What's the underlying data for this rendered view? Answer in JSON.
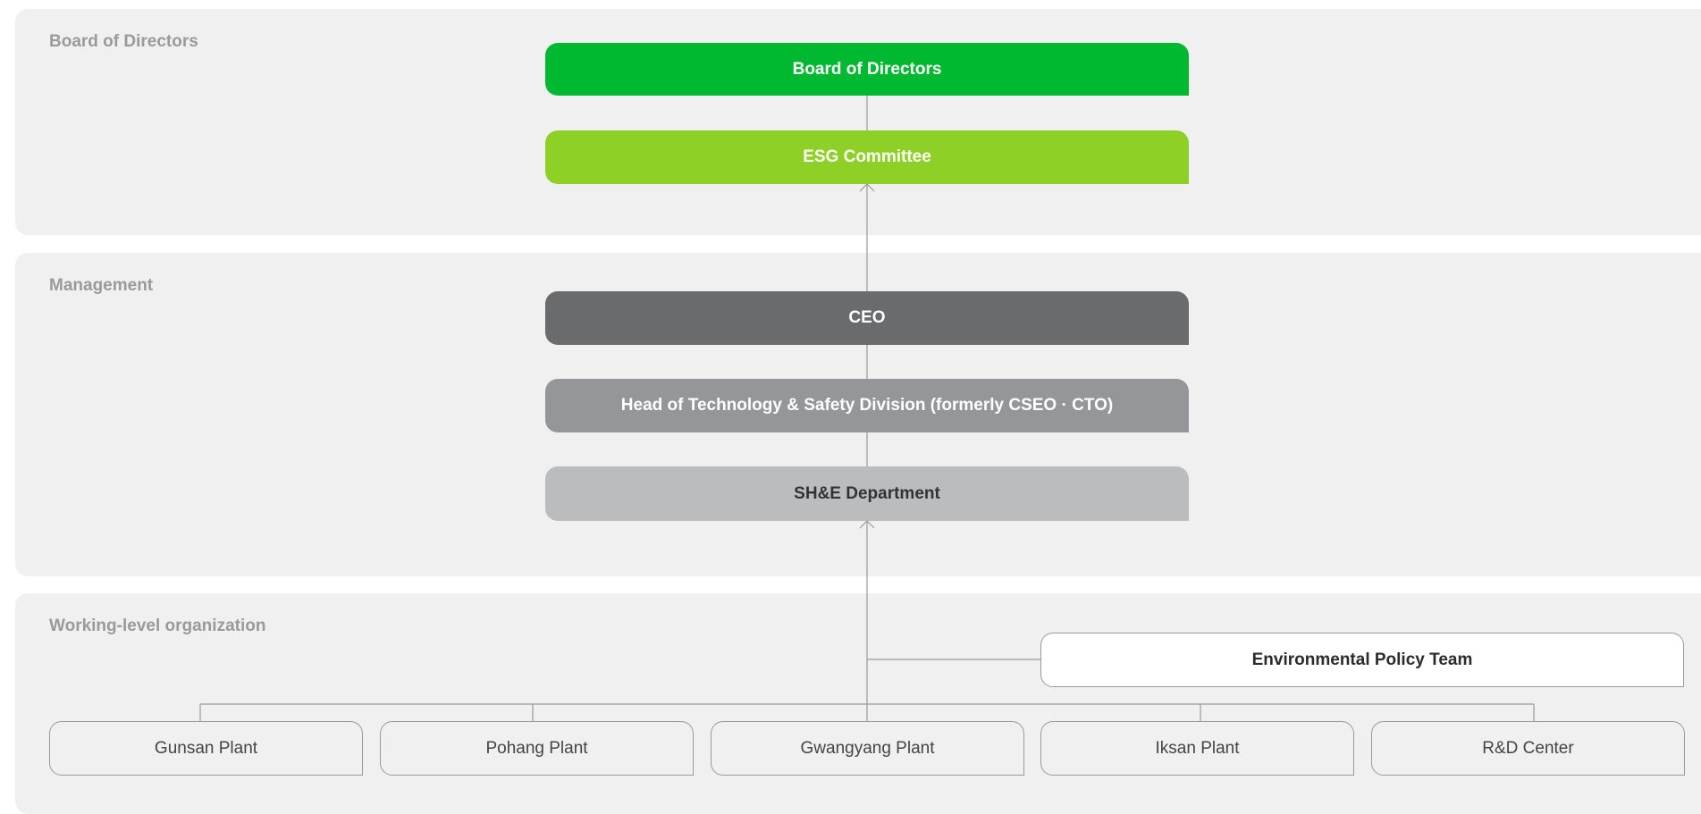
{
  "sections": {
    "board": {
      "title": "Board of Directors"
    },
    "management": {
      "title": "Management"
    },
    "working": {
      "title": "Working-level organization"
    }
  },
  "nodes": {
    "board_of_directors": "Board of Directors",
    "esg_committee": "ESG Committee",
    "ceo": "CEO",
    "head_tech_safety": "Head of Technology & Safety Division (formerly CSEO · CTO)",
    "she_department": "SH&E Department",
    "environmental_policy_team": "Environmental Policy Team"
  },
  "plants": [
    {
      "label": "Gunsan Plant"
    },
    {
      "label": "Pohang Plant"
    },
    {
      "label": "Gwangyang Plant"
    },
    {
      "label": "Iksan Plant"
    },
    {
      "label": "R&D Center"
    }
  ],
  "colors": {
    "board_green": "#00b931",
    "esg_lime": "#8fd027",
    "ceo_dark_gray": "#6a6b6d",
    "head_mid_gray": "#95969a",
    "she_light_gray": "#bbbcbe",
    "section_background": "#f0f0f0",
    "connector_line": "#9a9a9a"
  }
}
